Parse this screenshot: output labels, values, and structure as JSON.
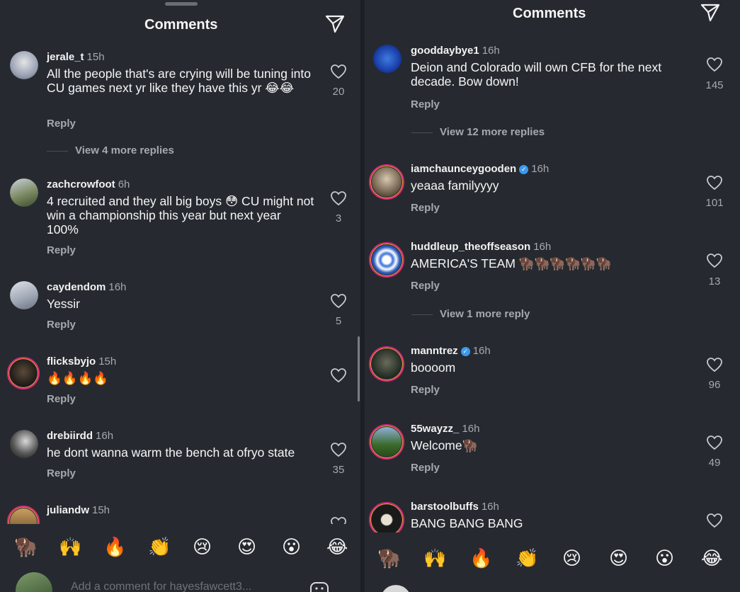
{
  "left": {
    "title": "Comments",
    "comments": [
      {
        "user": "jerale_t",
        "time": "15h",
        "text": "All the people that's are crying will be tuning into CU games next yr like they have this yr 😂😂",
        "reply": "Reply",
        "likes": "20",
        "more": "View 4 more replies"
      },
      {
        "user": "zachcrowfoot",
        "time": "6h",
        "text": "4 recruited and they all big boys 😳 CU might not win a championship this year but next year 100%",
        "reply": "Reply",
        "likes": "3"
      },
      {
        "user": "caydendom",
        "time": "16h",
        "text": "Yessir",
        "reply": "Reply",
        "likes": "5"
      },
      {
        "user": "flicksbyjo",
        "time": "15h",
        "text": "🔥🔥🔥🔥",
        "reply": "Reply",
        "likes": ""
      },
      {
        "user": "drebiirdd",
        "time": "16h",
        "text": "he dont wanna warm the bench at ofryo state",
        "reply": "Reply",
        "likes": "35"
      },
      {
        "user": "juliandw",
        "time": "15h"
      }
    ],
    "emojis": [
      "🦬",
      "🙌",
      "🔥",
      "👏",
      "😢",
      "😍",
      "😮",
      "😂"
    ],
    "compose_placeholder": "Add a comment for hayesfawcett3..."
  },
  "right": {
    "title": "Comments",
    "comments": [
      {
        "user": "gooddaybye1",
        "time": "16h",
        "text": "Deion and Colorado will own CFB for the next decade. Bow down!",
        "reply": "Reply",
        "likes": "145",
        "more": "View 12 more replies"
      },
      {
        "user": "iamchaunceygooden",
        "verified": true,
        "time": "16h",
        "text": "yeaaa familyyyy",
        "reply": "Reply",
        "likes": "101"
      },
      {
        "user": "huddleup_theoffseason",
        "time": "16h",
        "text": "AMERICA'S TEAM 🦬🦬🦬🦬🦬🦬",
        "reply": "Reply",
        "likes": "13",
        "more": "View 1 more reply"
      },
      {
        "user": "manntrez",
        "verified": true,
        "time": "16h",
        "text": "boooom",
        "reply": "Reply",
        "likes": "96"
      },
      {
        "user": "55wayzz_",
        "time": "16h",
        "text": "Welcome🦬",
        "reply": "Reply",
        "likes": "49"
      },
      {
        "user": "barstoolbuffs",
        "time": "16h",
        "text": "BANG BANG BANG"
      }
    ],
    "emojis": [
      "🦬",
      "🙌",
      "🔥",
      "👏",
      "😢",
      "😍",
      "😮",
      "😂"
    ]
  }
}
